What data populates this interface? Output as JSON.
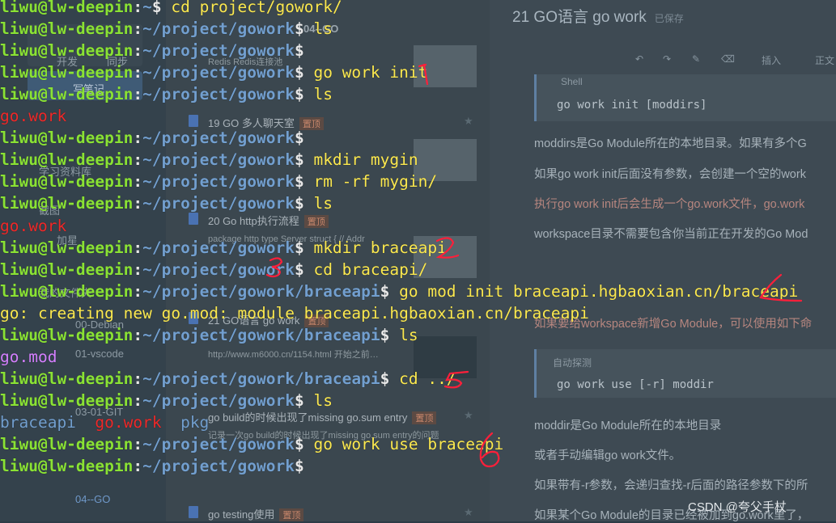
{
  "background": {
    "sidebar": {
      "items": [
        "开发",
        "同步",
        "写笔记",
        "学习资料库",
        "截图",
        "加星",
        "我的文件夹",
        "00-Debian",
        "01-vscode",
        "03-01-GIT",
        "04--GO"
      ]
    },
    "notes_list": {
      "folder": "04--GO",
      "items": [
        {
          "title": "19 GO 多人聊天室",
          "tag": "置顶",
          "sub": "Redis Redis连接池"
        },
        {
          "title": "20 Go http执行流程",
          "tag": "置顶",
          "sub": "package http type Server struct { // Addr"
        },
        {
          "title": "21 GO语言 go work",
          "tag": "置顶",
          "sub": "http://www.m6000.cn/1154.html 开始之前…"
        },
        {
          "title": "go build的时候出现了missing go.sum entry",
          "tag": "置顶",
          "sub": "记录一次go build的时候出现了missing go.sum entry的问题"
        },
        {
          "title": "go testing使用",
          "tag": "置顶",
          "sub": ""
        }
      ]
    },
    "editor": {
      "title": "21 GO语言 go work",
      "saved": "已保存",
      "toolbar": [
        "插入",
        "正文"
      ],
      "code1_label": "Shell",
      "code1": "go work init [moddirs]",
      "p1": "moddirs是Go Module所在的本地目录。如果有多个G",
      "p2": "如果go work init后面没有参数，会创建一个空的work",
      "p3": "执行go work init后会生成一个go.work文件，go.work",
      "p4": "workspace目录不需要包含你当前正在开发的Go Mod",
      "p5": "如果要给workspace新增Go Module，可以使用如下命",
      "code2_label": "自动探测",
      "code2": "go work use [-r] moddir",
      "p6": "moddir是Go Module所在的本地目录",
      "p7": "或者手动编辑go work文件。",
      "p8": "如果带有-r参数，会递归查找-r后面的路径参数下的所",
      "p9": "如果某个Go Module的目录已经被加到go.work里了，"
    },
    "watermark": "CSDN @夸父手杖"
  },
  "terminal": {
    "user": "liwu@lw-deepin",
    "lines": [
      {
        "type": "prompt",
        "path": "~",
        "cmd": "cd project/gowork/"
      },
      {
        "type": "prompt",
        "path": "~/project/gowork",
        "cmd": "ls"
      },
      {
        "type": "prompt",
        "path": "~/project/gowork",
        "cmd": ""
      },
      {
        "type": "prompt",
        "path": "~/project/gowork",
        "cmd": "go work init"
      },
      {
        "type": "prompt",
        "path": "~/project/gowork",
        "cmd": "ls"
      },
      {
        "type": "output",
        "color": "red",
        "text": "go.work"
      },
      {
        "type": "prompt",
        "path": "~/project/gowork",
        "cmd": ""
      },
      {
        "type": "prompt",
        "path": "~/project/gowork",
        "cmd": "mkdir mygin"
      },
      {
        "type": "prompt",
        "path": "~/project/gowork",
        "cmd": "rm -rf mygin/"
      },
      {
        "type": "prompt",
        "path": "~/project/gowork",
        "cmd": "ls"
      },
      {
        "type": "output",
        "color": "red",
        "text": "go.work"
      },
      {
        "type": "prompt",
        "path": "~/project/gowork",
        "cmd": "mkdir braceapi"
      },
      {
        "type": "prompt",
        "path": "~/project/gowork",
        "cmd": "cd braceapi/"
      },
      {
        "type": "prompt",
        "path": "~/project/gowork/braceapi",
        "cmd": "go mod init braceapi.hgbaoxian.cn/braceapi"
      },
      {
        "type": "output",
        "color": "yellow",
        "text": "go: creating new go.mod: module braceapi.hgbaoxian.cn/braceapi"
      },
      {
        "type": "prompt",
        "path": "~/project/gowork/braceapi",
        "cmd": "ls"
      },
      {
        "type": "output",
        "color": "pink",
        "text": "go.mod"
      },
      {
        "type": "prompt",
        "path": "~/project/gowork/braceapi",
        "cmd": "cd ../"
      },
      {
        "type": "prompt",
        "path": "~/project/gowork",
        "cmd": "ls"
      },
      {
        "type": "ls",
        "entries": [
          {
            "text": "braceapi",
            "color": "blue"
          },
          {
            "text": "go.work",
            "color": "red"
          },
          {
            "text": "pkg",
            "color": "blue"
          }
        ]
      },
      {
        "type": "prompt",
        "path": "~/project/gowork",
        "cmd": "go work use braceapi"
      },
      {
        "type": "prompt",
        "path": "~/project/gowork",
        "cmd": ""
      }
    ]
  },
  "annotations": [
    "1",
    "2",
    "3",
    "4",
    "5",
    "6"
  ],
  "colors": {
    "annotation": "#ff1f3a",
    "prompt_user": "#8ae234",
    "prompt_path": "#729fcf",
    "command": "#fce94f"
  }
}
